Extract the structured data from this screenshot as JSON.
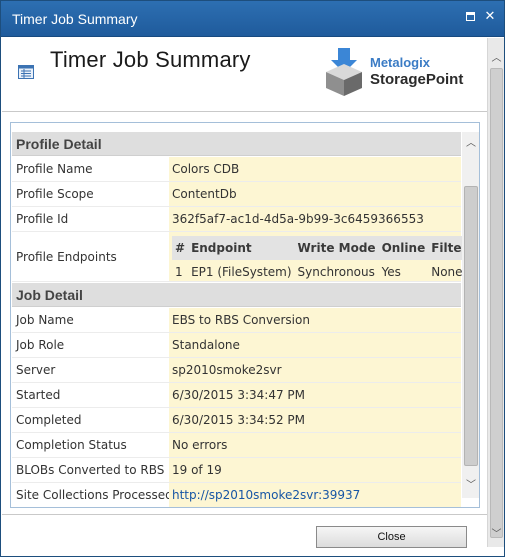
{
  "window": {
    "title": "Timer Job Summary"
  },
  "header": {
    "page_title": "Timer Job Summary"
  },
  "logo": {
    "brand_top": "Metalogix",
    "brand_bottom": "StoragePoint"
  },
  "profile_detail": {
    "heading": "Profile Detail",
    "rows": [
      {
        "label": "Profile Name",
        "value": "Colors CDB"
      },
      {
        "label": "Profile Scope",
        "value": "ContentDb"
      },
      {
        "label": "Profile Id",
        "value": "362f5af7-ac1d-4d5a-9b99-3c6459366553"
      }
    ],
    "endpoints_label": "Profile Endpoints",
    "endpoints_table": {
      "headers": [
        "#",
        "Endpoint",
        "Write Mode",
        "Online",
        "Filter"
      ],
      "rows": [
        [
          "1",
          "EP1 (FileSystem)",
          "Synchronous",
          "Yes",
          "None"
        ]
      ]
    }
  },
  "job_detail": {
    "heading": "Job Detail",
    "rows": [
      {
        "label": "Job Name",
        "value": "EBS to RBS Conversion"
      },
      {
        "label": "Job Role",
        "value": "Standalone"
      },
      {
        "label": "Server",
        "value": "sp2010smoke2svr"
      },
      {
        "label": "Started",
        "value": "6/30/2015 3:34:47 PM"
      },
      {
        "label": "Completed",
        "value": "6/30/2015 3:34:52 PM"
      },
      {
        "label": "Completion Status",
        "value": "No errors"
      },
      {
        "label": "BLOBs Converted to RBS",
        "value": "19 of 19"
      },
      {
        "label": "Site Collections Processed",
        "value": "http://sp2010smoke2svr:39937"
      }
    ]
  },
  "footer": {
    "close_label": "Close"
  },
  "icons": {
    "maximize": "maximize-icon",
    "close": "close-icon",
    "list": "list-icon",
    "logo": "storagepoint-logo-icon",
    "scroll_up": "scroll-up-icon",
    "scroll_down": "scroll-down-icon"
  },
  "colors": {
    "titlebar": "#2566a8",
    "value_bg": "#fdf6d3",
    "link": "#1756a5",
    "section_bg": "#dedede"
  }
}
